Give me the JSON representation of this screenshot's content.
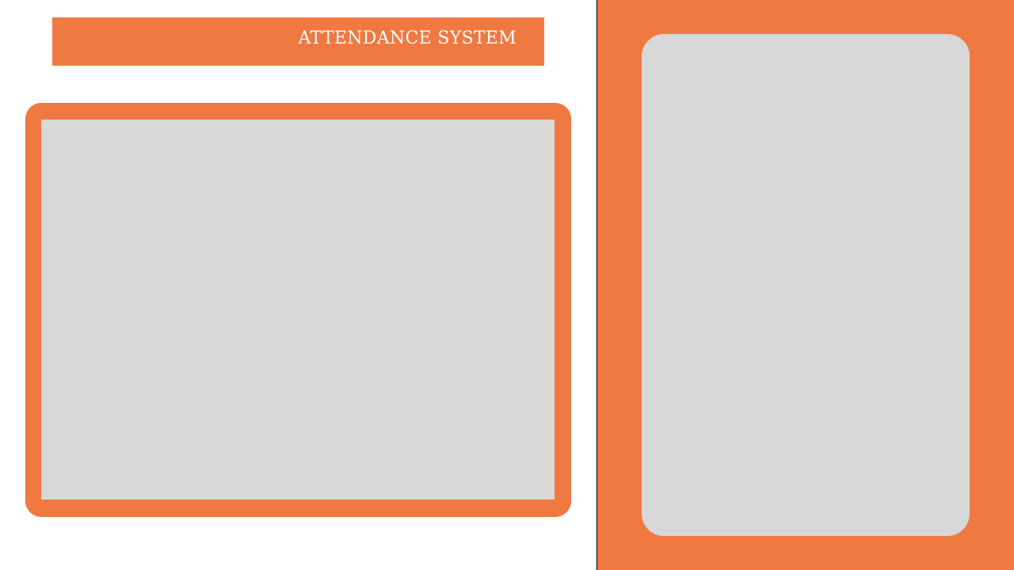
{
  "header": {
    "title": "ATTENDANCE SYSTEM"
  },
  "colors": {
    "accent": "#f07942",
    "placeholder": "#d8d8d8",
    "title_text": "#ffffff",
    "divider": "#000000"
  }
}
